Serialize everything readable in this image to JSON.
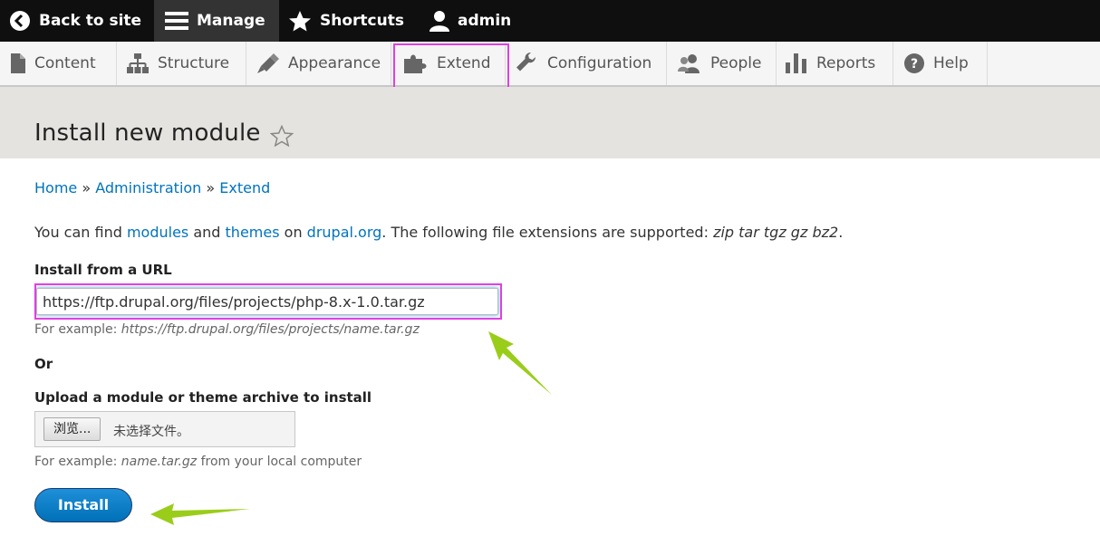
{
  "toolbar": {
    "back_label": "Back to site",
    "manage_label": "Manage",
    "shortcuts_label": "Shortcuts",
    "user_label": "admin"
  },
  "tray": {
    "items": [
      {
        "label": "Content",
        "icon": "page-icon"
      },
      {
        "label": "Structure",
        "icon": "sitemap-icon"
      },
      {
        "label": "Appearance",
        "icon": "paintbrush-icon"
      },
      {
        "label": "Extend",
        "icon": "puzzle-icon"
      },
      {
        "label": "Configuration",
        "icon": "wrench-icon"
      },
      {
        "label": "People",
        "icon": "people-icon"
      },
      {
        "label": "Reports",
        "icon": "bar-chart-icon"
      },
      {
        "label": "Help",
        "icon": "help-icon"
      }
    ]
  },
  "page": {
    "title": "Install new module"
  },
  "breadcrumb": {
    "items": [
      "Home",
      "Administration",
      "Extend"
    ],
    "separator": "»"
  },
  "description": {
    "prefix": "You can find ",
    "link_modules": "modules",
    "and": " and ",
    "link_themes": "themes",
    "on": " on ",
    "link_drupal": "drupal.org",
    "suffix": ". The following file extensions are supported: ",
    "extensions": "zip tar tgz gz bz2",
    "end": "."
  },
  "url_section": {
    "label": "Install from a URL",
    "value": "https://ftp.drupal.org/files/projects/php-8.x-1.0.tar.gz",
    "help_prefix": "For example: ",
    "help_example": "https://ftp.drupal.org/files/projects/name.tar.gz"
  },
  "or_label": "Or",
  "upload_section": {
    "label": "Upload a module or theme archive to install",
    "browse_label": "浏览...",
    "no_file_label": "未选择文件。",
    "help_prefix": "For example: ",
    "help_example": "name.tar.gz",
    "help_suffix": " from your local computer"
  },
  "install_button": "Install",
  "colors": {
    "toolbar_bg": "#0f0f0f",
    "link": "#0074bd",
    "highlight": "#e040e0",
    "arrow": "#9acd1a",
    "button": "#0071b8"
  }
}
